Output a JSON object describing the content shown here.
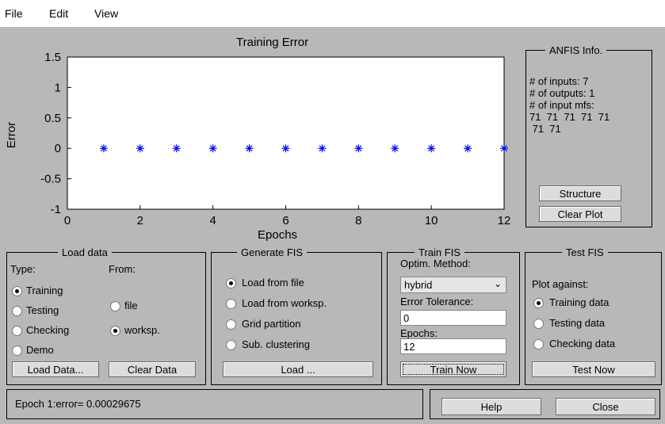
{
  "menu": [
    "File",
    "Edit",
    "View"
  ],
  "chart_data": {
    "type": "scatter",
    "title": "Training Error",
    "xlabel": "Epochs",
    "ylabel": "Error",
    "xlim": [
      0,
      12
    ],
    "ylim": [
      -1,
      1.5
    ],
    "xticks": [
      "0",
      "2",
      "4",
      "6",
      "8",
      "10",
      "12"
    ],
    "yticks": [
      "1.5",
      "1",
      "0.5",
      "0",
      "-0.5",
      "-1"
    ],
    "marker": "*",
    "color": "#0000ff",
    "x": [
      1,
      2,
      3,
      4,
      5,
      6,
      7,
      8,
      9,
      10,
      11,
      12
    ],
    "y": [
      0,
      0,
      0,
      0,
      0,
      0,
      0,
      0,
      0,
      0,
      0,
      0
    ]
  },
  "anfis_info": {
    "title": "ANFIS Info.",
    "lines": [
      "# of inputs: 7",
      "# of outputs: 1",
      "# of input mfs:",
      "71  71  71  71  71",
      " 71  71"
    ],
    "structure_button": "Structure",
    "clear_plot_button": "Clear Plot"
  },
  "load_data": {
    "title": "Load data",
    "type_label": "Type:",
    "from_label": "From:",
    "types": [
      "Training",
      "Testing",
      "Checking",
      "Demo"
    ],
    "selected_type": "Training",
    "sources": [
      "file",
      "worksp."
    ],
    "selected_source": "worksp.",
    "load_button": "Load Data...",
    "clear_button": "Clear Data"
  },
  "generate_fis": {
    "title": "Generate FIS",
    "options": [
      "Load from file",
      "Load from worksp.",
      "Grid partition",
      "Sub. clustering"
    ],
    "selected": "Load from file",
    "load_button": "Load ..."
  },
  "train_fis": {
    "title": "Train FIS",
    "method_label": "Optim. Method:",
    "method_value": "hybrid",
    "tolerance_label": "Error Tolerance:",
    "tolerance_value": "0",
    "epochs_label": "Epochs:",
    "epochs_value": "12",
    "train_button": "Train Now"
  },
  "test_fis": {
    "title": "Test FIS",
    "plot_against_label": "Plot against:",
    "options": [
      "Training data",
      "Testing data",
      "Checking data"
    ],
    "selected": "Training data",
    "test_button": "Test Now"
  },
  "status": {
    "message": "Epoch 1:error= 0.00029675"
  },
  "bottom": {
    "help_button": "Help",
    "close_button": "Close"
  }
}
